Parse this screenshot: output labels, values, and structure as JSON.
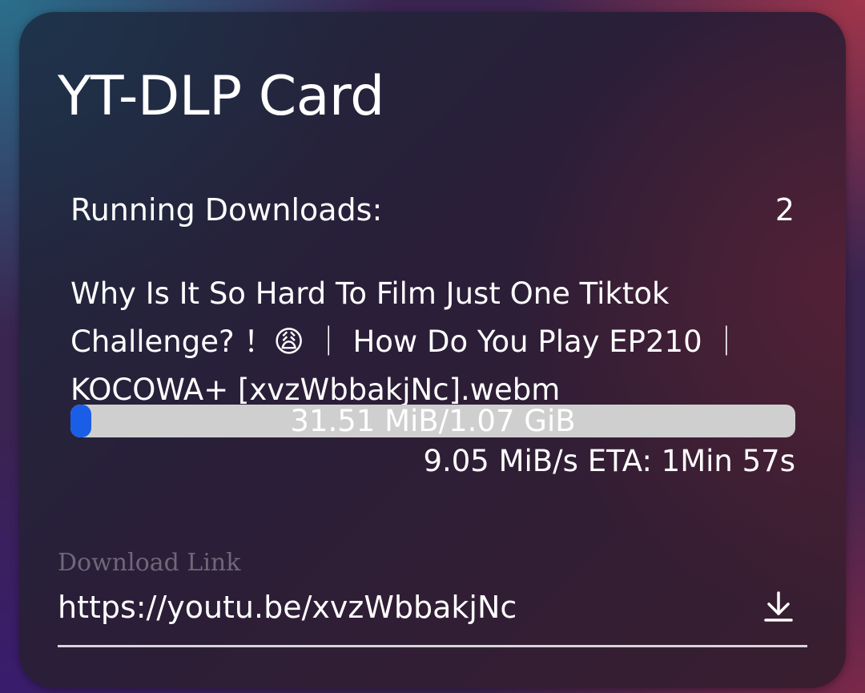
{
  "card": {
    "title": "YT-DLP Card"
  },
  "running": {
    "label": "Running Downloads:",
    "count": "2"
  },
  "download": {
    "filename": "Why Is It So Hard To Film Just One Tiktok Challenge? ！😩 ｜ How Do You Play EP210 ｜ KOCOWA+ [xvzWbbakjNc].webm",
    "progress_text": "31.51 MiB/1.07 GiB",
    "progress_fraction": 0.0288,
    "speed_eta": "9.05 MiB/s ETA: 1Min 57s"
  },
  "link": {
    "label": "Download Link",
    "value": "https://youtu.be/xvzWbbakjNc",
    "icon": "download-icon"
  },
  "colors": {
    "progress_fill": "#1a5ee8",
    "progress_track": "#cfcfcf",
    "label_muted": "#6e6878"
  }
}
